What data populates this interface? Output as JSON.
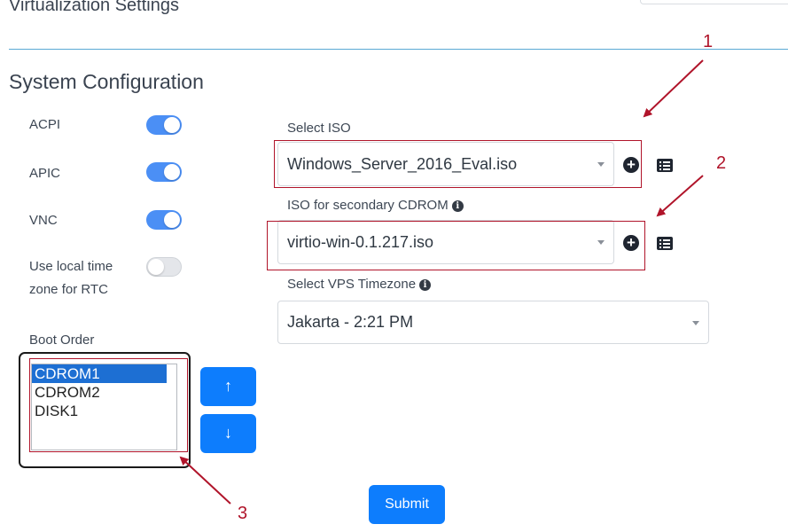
{
  "header": {
    "title": "Virtualization Settings"
  },
  "section": {
    "title": "System Configuration"
  },
  "toggles": [
    {
      "label": "ACPI",
      "state": "on"
    },
    {
      "label": "APIC",
      "state": "on"
    },
    {
      "label": "VNC",
      "state": "on"
    },
    {
      "label": "Use local time zone for RTC",
      "label_line1": "Use local time",
      "label_line2": "zone for RTC",
      "state": "off"
    }
  ],
  "iso": {
    "label": "Select ISO",
    "value": "Windows_Server_2016_Eval.iso"
  },
  "secondary_cdrom": {
    "label": "ISO for secondary CDROM",
    "value": "virtio-win-0.1.217.iso"
  },
  "timezone": {
    "label": "Select VPS Timezone",
    "value": "Jakarta - 2:21 PM"
  },
  "boot_order": {
    "label": "Boot Order",
    "options": [
      "CDROM1",
      "CDROM2",
      "DISK1"
    ],
    "selected": "CDROM1",
    "up_label": "↑",
    "down_label": "↓"
  },
  "submit_label": "Submit",
  "annotations": {
    "n1": "1",
    "n2": "2",
    "n3": "3",
    "color": "#b0142a"
  },
  "colors": {
    "accent": "#0d7dfd",
    "toggle_on": "#4b8ff5",
    "divider": "#5aa9d4"
  },
  "icons": {
    "info": "info-circle-icon",
    "add": "plus-circle-icon",
    "list": "list-icon",
    "caret": "chevron-down-icon"
  }
}
